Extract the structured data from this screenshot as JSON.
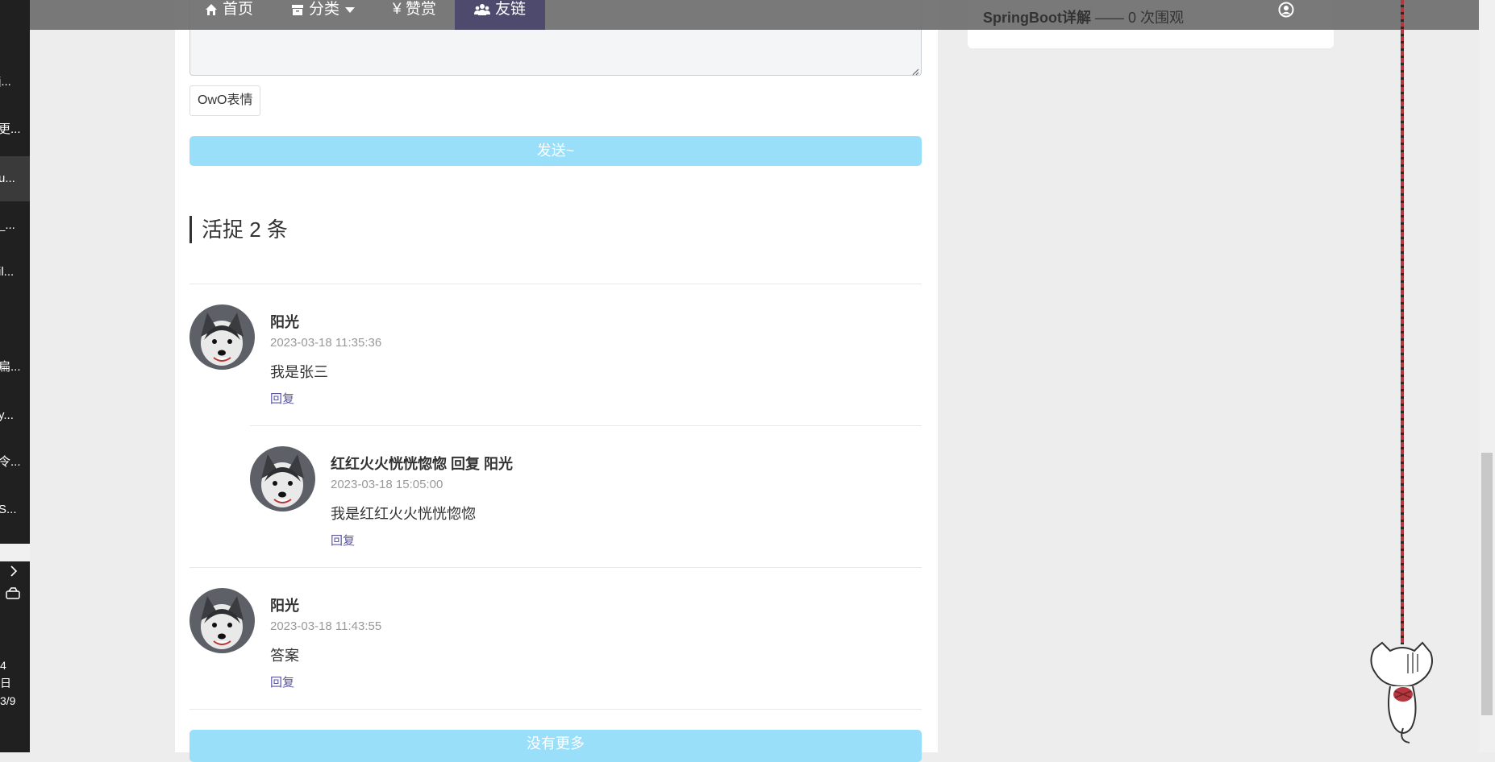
{
  "os_sidebar": {
    "items": [
      "j...",
      "更...",
      "u...",
      "_...",
      "il...",
      "",
      "扁...",
      "y...",
      "令...",
      "S..."
    ],
    "clock": [
      "4",
      "日",
      "3/9"
    ]
  },
  "nav": {
    "items": [
      {
        "icon": "home-icon",
        "label": "首页"
      },
      {
        "icon": "archive-icon",
        "label": "分类"
      },
      {
        "icon": "yen-icon",
        "label": "¥ 赞赏"
      },
      {
        "icon": "users-icon",
        "label": "友链"
      }
    ],
    "blog_title": "SpringBoot详解",
    "blog_views": "—— 0 次围观"
  },
  "editor": {
    "owo_label": "OwO表情",
    "send_label": "发送~"
  },
  "comments_section": {
    "title": "活捉 2 条"
  },
  "comments": [
    {
      "author": "阳光",
      "time": "2023-03-18 11:35:36",
      "content": "我是张三",
      "reply_label": "回复"
    },
    {
      "author": "红红火火恍恍惚惚 回复 阳光",
      "time": "2023-03-18 15:05:00",
      "content": "我是红红火火恍恍惚惚",
      "reply_label": "回复"
    },
    {
      "author": "阳光",
      "time": "2023-03-18 11:43:55",
      "content": "答案",
      "reply_label": "回复"
    }
  ],
  "more_label": "没有更多",
  "colors": {
    "accent_button": "#99dffa",
    "nav_active": "#4e4a6e",
    "reply_link": "#5b55a0"
  }
}
